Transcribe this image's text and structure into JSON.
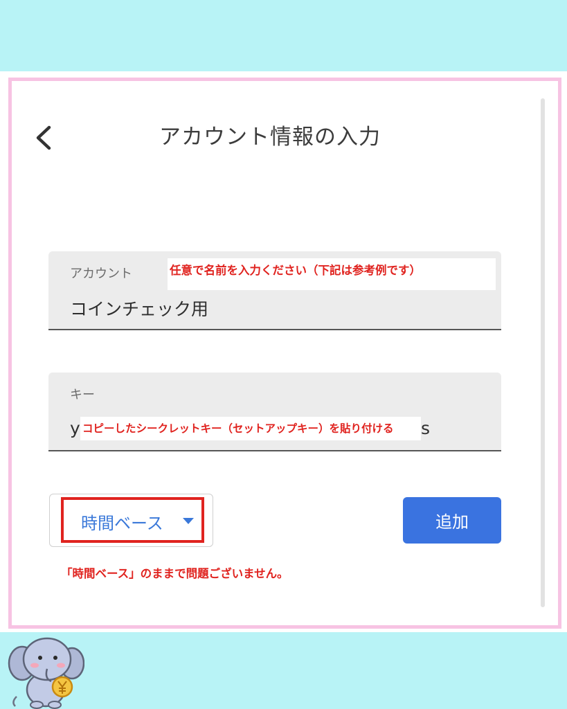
{
  "header": {
    "back_icon": "chevron-left-icon",
    "title": "アカウント情報の入力"
  },
  "form": {
    "account": {
      "label": "アカウント",
      "value": "コインチェック用",
      "annotation": "任意で名前を入力ください（下記は参考例です）"
    },
    "key": {
      "label": "キー",
      "value_prefix": "y",
      "value_suffix": "s",
      "annotation": "コピーしたシークレットキー（セットアップキー）を貼り付ける"
    },
    "type_select": {
      "value": "時間ベース",
      "icon": "dropdown-arrow-icon"
    },
    "add_button_label": "追加",
    "select_annotation": "「時間ベース」のままで問題ございません。"
  },
  "colors": {
    "background_band": "#b8f3f6",
    "frame_border": "#f7c3e3",
    "accent_blue": "#3a73e0",
    "annotation_red": "#e0231f",
    "field_bg": "#ececec"
  },
  "decor": {
    "mascot_icon": "elephant-mascot-icon",
    "coin_icon": "yen-coin-icon"
  }
}
